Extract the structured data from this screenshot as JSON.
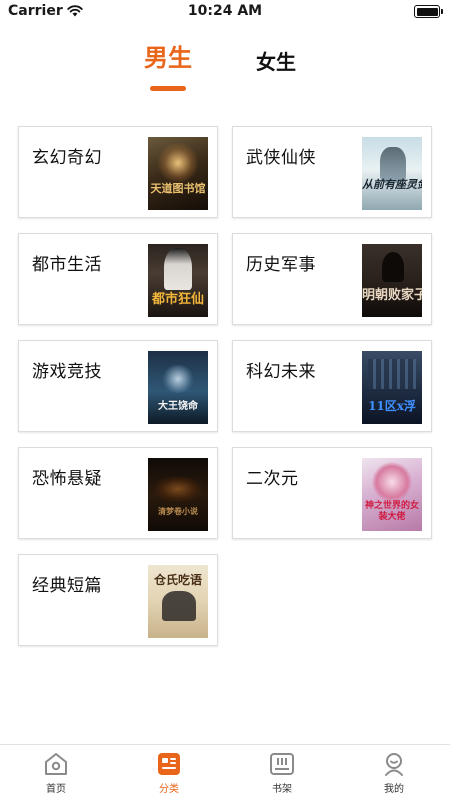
{
  "status_bar": {
    "carrier": "Carrier",
    "time": "10:24 AM",
    "battery_level": 1.0
  },
  "gender_tabs": [
    {
      "label": "男生",
      "active": true
    },
    {
      "label": "女生",
      "active": false
    }
  ],
  "categories": [
    {
      "label": "玄幻奇幻",
      "cover_title": "天道图书馆"
    },
    {
      "label": "武侠仙侠",
      "cover_title": "从前有座灵剑山"
    },
    {
      "label": "都市生活",
      "cover_title": "都市狂仙"
    },
    {
      "label": "历史军事",
      "cover_title": "明朝败家子"
    },
    {
      "label": "游戏竞技",
      "cover_title": "大王饶命"
    },
    {
      "label": "科幻未来",
      "cover_title": "11区x浮"
    },
    {
      "label": "恐怖悬疑",
      "cover_title": "清梦卷小说"
    },
    {
      "label": "二次元",
      "cover_title": "神之世界的女装大佬"
    },
    {
      "label": "经典短篇",
      "cover_title": "仓氏吃语"
    }
  ],
  "tab_bar": {
    "items": [
      {
        "label": "首页",
        "icon": "home-icon",
        "active": false
      },
      {
        "label": "分类",
        "icon": "category-icon",
        "active": true
      },
      {
        "label": "书架",
        "icon": "bookshelf-icon",
        "active": false
      },
      {
        "label": "我的",
        "icon": "profile-icon",
        "active": false
      }
    ]
  },
  "colors": {
    "accent": "#e8651a",
    "text": "#111111",
    "card_border": "#dcdcdc",
    "tab_inactive": "#8a8a8a"
  }
}
